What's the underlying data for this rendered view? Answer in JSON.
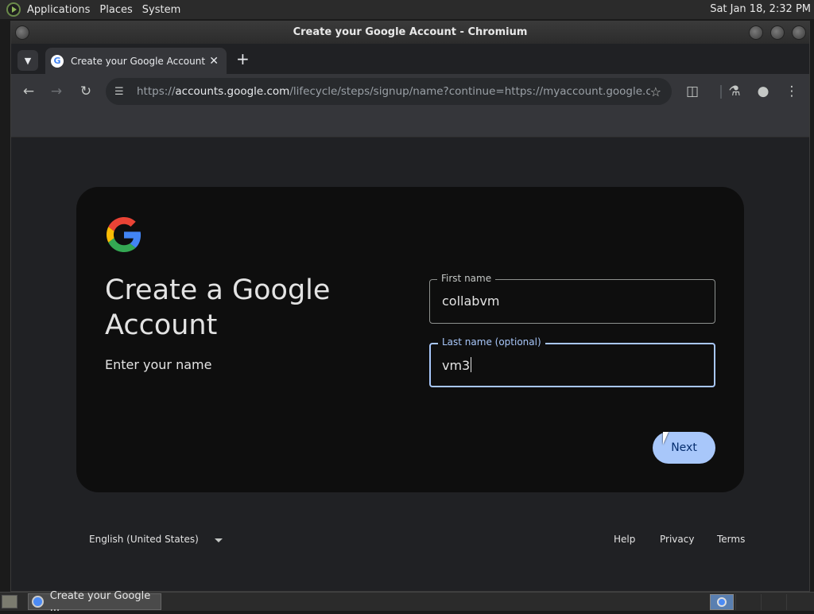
{
  "system_panel": {
    "menus": [
      "Applications",
      "Places",
      "System"
    ],
    "clock": "Sat Jan 18,  2:32 PM"
  },
  "window": {
    "title": "Create your Google Account - Chromium"
  },
  "browser": {
    "tab_title": "Create your Google Account",
    "url_prefix": "https://",
    "url_host": "accounts.google.com",
    "url_path": "/lifecycle/steps/signup/name?continue=https://myaccount.google.co..."
  },
  "page": {
    "heading": "Create a Google Account",
    "subtitle": "Enter your name",
    "first_name": {
      "label": "First name",
      "value": "collabvm"
    },
    "last_name": {
      "label": "Last name (optional)",
      "value": "vm3"
    },
    "next_label": "Next",
    "colors": {
      "accent": "#a8c7fa",
      "card": "#0e0e0e",
      "page": "#202124"
    }
  },
  "footer": {
    "language": "English (United States)",
    "links": [
      "Help",
      "Privacy",
      "Terms"
    ]
  },
  "taskbar": {
    "item": "Create your Google ..."
  }
}
